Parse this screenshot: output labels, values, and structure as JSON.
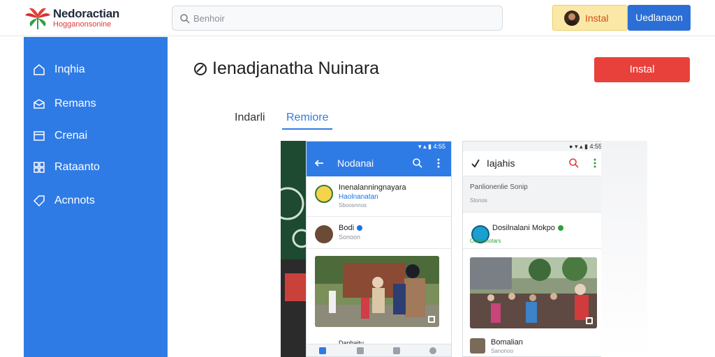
{
  "header": {
    "brand_title": "Nedoractian",
    "brand_sub": "Hogganonsonine",
    "search_placeholder": "Benhoir",
    "install_top_label": "Instal",
    "download_label": "Uedlanaon"
  },
  "sidebar": {
    "items": [
      {
        "label": "Inqhia",
        "icon": "home-icon"
      },
      {
        "label": "Remans",
        "icon": "inbox-icon"
      },
      {
        "label": "Crenai",
        "icon": "list-icon"
      },
      {
        "label": "Rataanto",
        "icon": "grid-icon"
      },
      {
        "label": "Acnnots",
        "icon": "tag-icon"
      }
    ]
  },
  "main": {
    "app_title": "Ienadjanatha Nuinara",
    "install_label": "Instal",
    "tabs": [
      {
        "label": "Indarli",
        "active": false
      },
      {
        "label": "Remiore",
        "active": true
      }
    ]
  },
  "screenshots": {
    "phone1": {
      "app_bar_title": "Nodanai",
      "items": [
        {
          "title": "Inenalanningnayara",
          "sub": "Haolnanatan",
          "meta": "Sboosnnos"
        },
        {
          "title": "Bodi",
          "meta": "Sonoon"
        }
      ],
      "bottom_item": "Danbaitu"
    },
    "phone2": {
      "app_bar_title": "Iajahis",
      "header_line": "Panlionenlie Sonip",
      "header_meta": "Stonos",
      "items": [
        {
          "title": "Dosilnalani Mokpo",
          "meta": "Ordnonotars"
        }
      ],
      "bottom_item": "Bomalian",
      "bottom_meta": "Sanonoo"
    }
  },
  "colors": {
    "accent": "#2f7be6",
    "install_red": "#e8403b",
    "download_blue": "#2b6fd6",
    "install_top_bg": "#fbe8a6"
  }
}
